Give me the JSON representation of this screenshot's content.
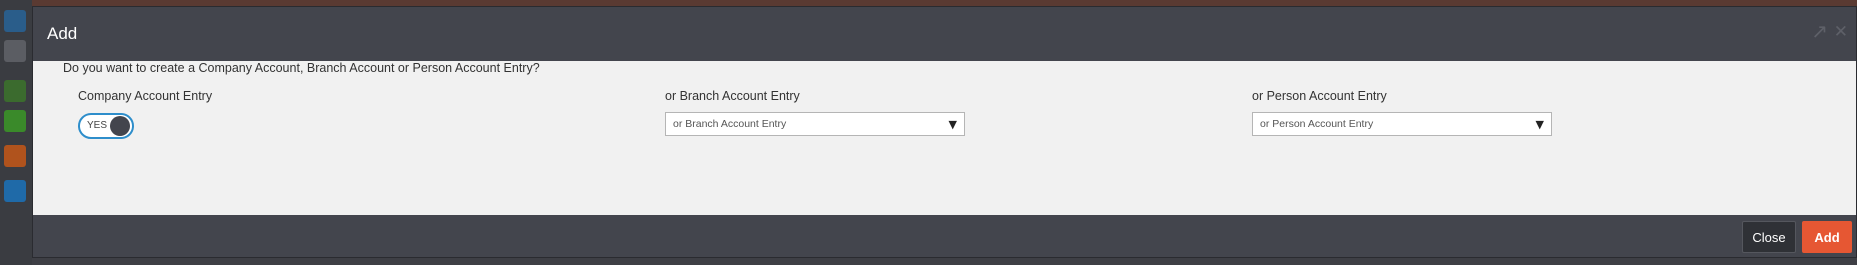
{
  "modal": {
    "title": "Add",
    "question": "Do you want to create a Company Account, Branch Account or Person Account Entry?",
    "company": {
      "label": "Company Account Entry",
      "toggle_text": "YES",
      "toggle_on": true
    },
    "branch": {
      "label": "or Branch Account Entry",
      "select_value": "or Branch Account Entry"
    },
    "person": {
      "label": "or Person Account Entry",
      "select_value": "or Person Account Entry"
    },
    "footer": {
      "close_label": "Close",
      "add_label": "Add"
    }
  },
  "icons": {
    "pin": "pin-icon",
    "close": "close-icon",
    "dropdown": "chevron-down-icon"
  },
  "colors": {
    "header": "#43454d",
    "body": "#f1f1f1",
    "accent_toggle": "#2e8ecb",
    "add_button": "#e65733"
  }
}
